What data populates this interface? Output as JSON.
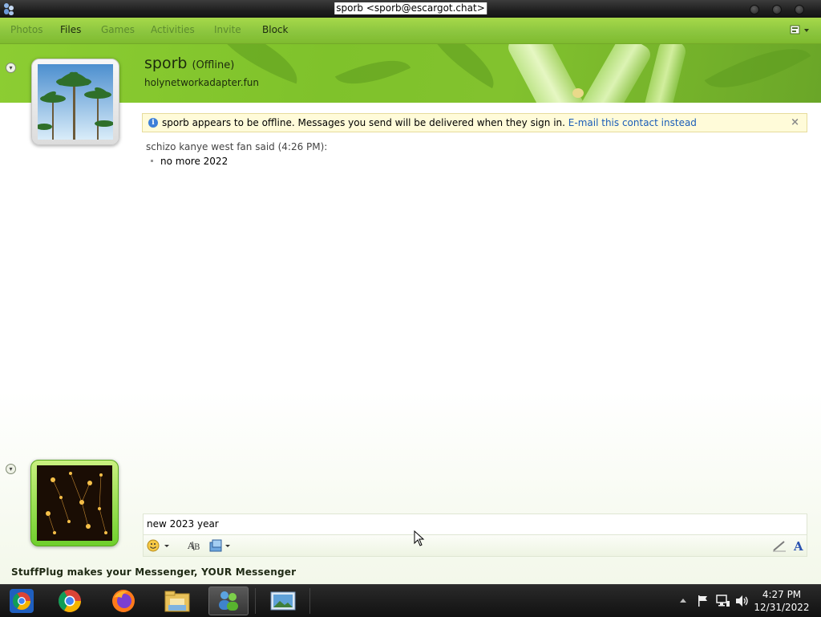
{
  "window": {
    "title": "sporb <sporb@escargot.chat>"
  },
  "menu": {
    "items": [
      {
        "label": "Photos",
        "enabled": false
      },
      {
        "label": "Files",
        "enabled": true
      },
      {
        "label": "Games",
        "enabled": false
      },
      {
        "label": "Activities",
        "enabled": false
      },
      {
        "label": "Invite",
        "enabled": false
      },
      {
        "label": "Block",
        "enabled": true
      }
    ]
  },
  "contact": {
    "name": "sporb",
    "status": "(Offline)",
    "personal_message": "holynetworkadapter.fun"
  },
  "infobar": {
    "text": "sporb appears to be offline. Messages you send will be delivered when they sign in.",
    "link": "E-mail this contact instead",
    "close": "×"
  },
  "conversation": {
    "said_line": "schizo kanye west fan said (4:26 PM):",
    "message": "no more 2022"
  },
  "input": {
    "value": "new 2023 year"
  },
  "footer": {
    "text": "StuffPlug makes your Messenger, YOUR Messenger"
  },
  "clock": {
    "time": "4:27 PM",
    "date": "12/31/2022"
  },
  "colors": {
    "accent_green": "#8cc63f",
    "link_blue": "#1a5db8",
    "infobar_bg": "#fffbd9"
  },
  "icons": [
    "app-icon",
    "layout-icon",
    "info-icon",
    "emoticon-icon",
    "spellcheck-icon",
    "send-file-icon",
    "handwriting-icon",
    "font-icon",
    "chrome-icon",
    "firefox-icon",
    "explorer-icon",
    "messenger-icon",
    "photo-viewer-icon",
    "flag-icon",
    "network-icon",
    "volume-icon"
  ]
}
